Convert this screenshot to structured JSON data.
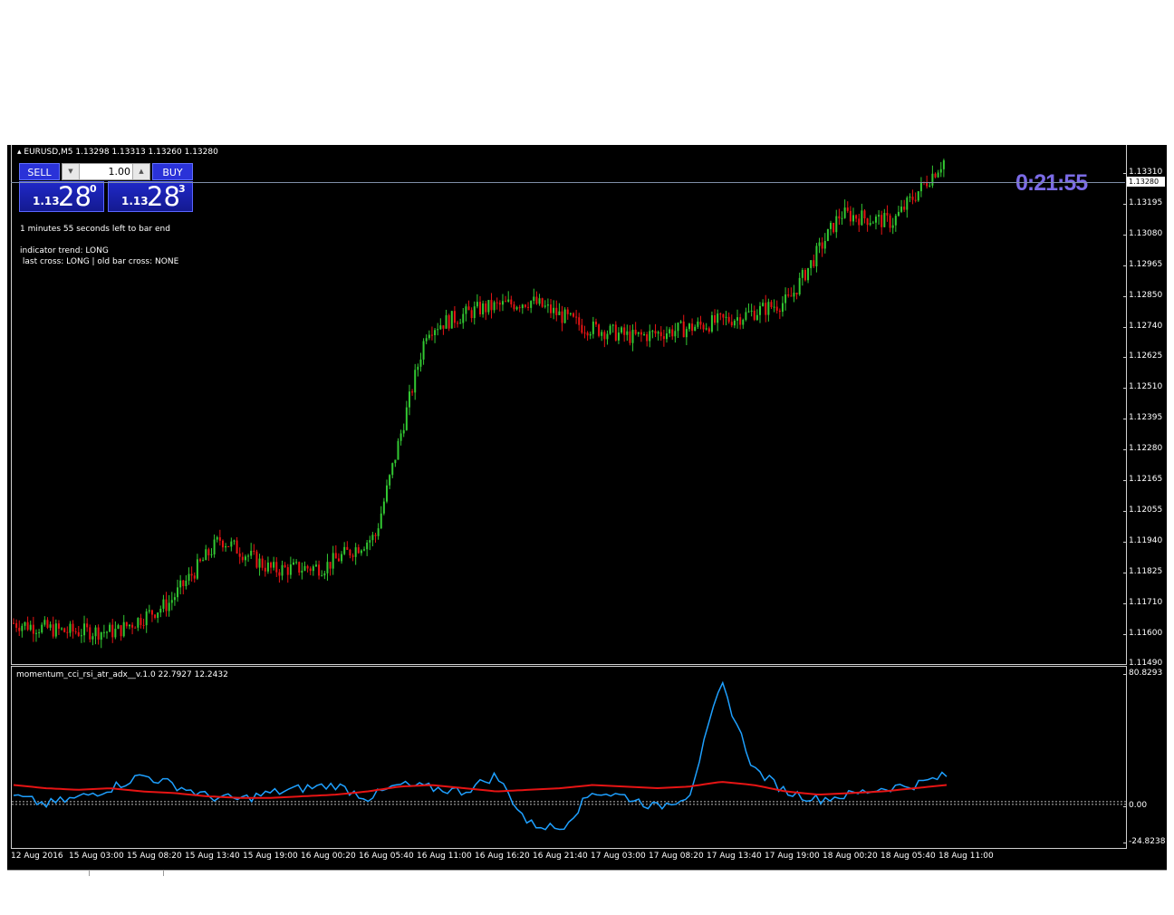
{
  "header": {
    "symbol_line": "EURUSD,M5  1.13298 1.13313 1.13260 1.13280"
  },
  "trade_panel": {
    "sell_label": "SELL",
    "buy_label": "BUY",
    "lot_value": "1.00",
    "sell_price": {
      "small": "1.13",
      "big": "28",
      "sup": "0"
    },
    "buy_price": {
      "small": "1.13",
      "big": "28",
      "sup": "3"
    }
  },
  "info": {
    "bar_timer": "1 minutes 55 seconds left to bar end",
    "trend": "indicator trend: LONG",
    "cross": " last cross: LONG | old bar cross: NONE"
  },
  "countdown": "0:21:55",
  "bid_label": "1.13280",
  "price_ticks": [
    "1.13310",
    "1.13195",
    "1.13080",
    "1.12965",
    "1.12850",
    "1.12740",
    "1.12625",
    "1.12510",
    "1.12395",
    "1.12280",
    "1.12165",
    "1.12055",
    "1.11940",
    "1.11825",
    "1.11710",
    "1.11600",
    "1.11490"
  ],
  "indicator": {
    "label": "momentum_cci_rsi_atr_adx__v.1.0 22.7927 12.2432",
    "ticks": [
      "80.8293",
      "0.00",
      "-24.8238"
    ]
  },
  "time_ticks": [
    "12 Aug 2016",
    "15 Aug 03:00",
    "15 Aug 08:20",
    "15 Aug 13:40",
    "15 Aug 19:00",
    "16 Aug 00:20",
    "16 Aug 05:40",
    "16 Aug 11:00",
    "16 Aug 16:20",
    "16 Aug 21:40",
    "17 Aug 03:00",
    "17 Aug 08:20",
    "17 Aug 13:40",
    "17 Aug 19:00",
    "18 Aug 00:20",
    "18 Aug 05:40",
    "18 Aug 11:00"
  ],
  "colors": {
    "background": "#000000",
    "bull": "#32c832",
    "bear": "#e61414",
    "indicator_main": "#1ea0ff",
    "indicator_signal": "#e61414",
    "countdown": "#7b6be6",
    "button": "#2a32d8"
  },
  "chart_data": [
    {
      "type": "line",
      "title": "EURUSD,M5",
      "ylim": [
        1.1149,
        1.1331
      ],
      "x": [
        "12 Aug 2016",
        "15 Aug 03:00",
        "15 Aug 08:20",
        "15 Aug 13:40",
        "15 Aug 19:00",
        "16 Aug 00:20",
        "16 Aug 05:40",
        "16 Aug 11:00",
        "16 Aug 16:20",
        "16 Aug 21:40",
        "17 Aug 03:00",
        "17 Aug 08:20",
        "17 Aug 13:40",
        "17 Aug 19:00",
        "18 Aug 00:20",
        "18 Aug 05:40",
        "18 Aug 11:00"
      ],
      "series": [
        {
          "values": [
            1.1163,
            1.116,
            1.116,
            1.117,
            1.1193,
            1.1182,
            1.1183,
            1.1194,
            1.1268,
            1.1275,
            1.1278,
            1.1269,
            1.1265,
            1.1268,
            1.1272,
            1.1278,
            1.1309,
            1.1306,
            1.1328
          ]
        }
      ]
    },
    {
      "type": "line",
      "title": "momentum_cci_rsi_atr_adx__v.1.0",
      "ylim": [
        -24.8238,
        80.8293
      ],
      "series": [
        {
          "values": [
            5,
            0,
            4,
            10,
            18,
            12,
            5,
            3,
            7,
            10,
            12,
            4,
            12,
            10,
            8,
            18,
            -12,
            -15,
            8,
            5,
            -2,
            6,
            75,
            22,
            8,
            3,
            6,
            10,
            12,
            18
          ]
        },
        {
          "values": [
            12,
            10,
            9,
            10,
            8,
            7,
            5,
            4,
            4,
            5,
            6,
            8,
            11,
            12,
            10,
            8,
            9,
            10,
            12,
            11,
            10,
            11,
            14,
            12,
            8,
            6,
            7,
            8,
            10,
            12
          ]
        }
      ]
    }
  ]
}
